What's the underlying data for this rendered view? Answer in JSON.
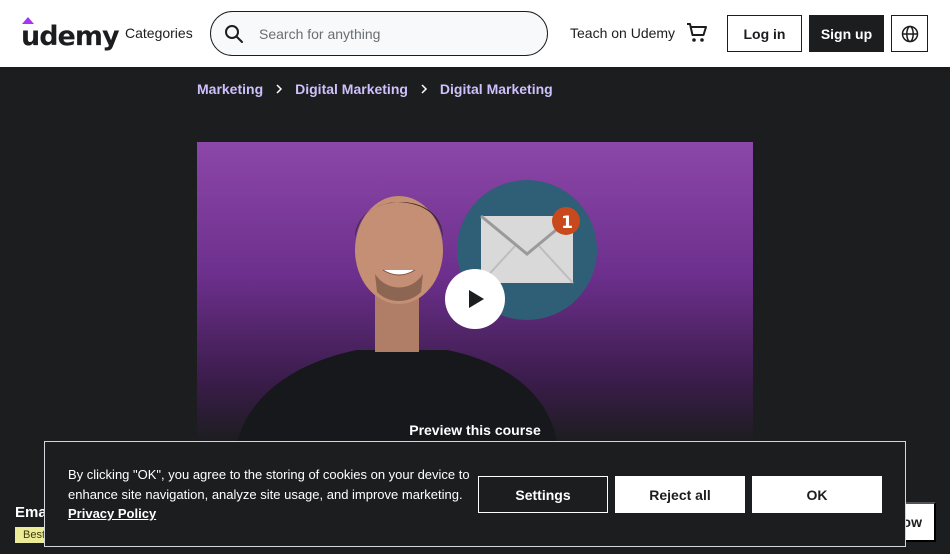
{
  "header": {
    "logo_text": "udemy",
    "categories_label": "Categories",
    "search_placeholder": "Search for anything",
    "teach_label": "Teach on Udemy",
    "login_label": "Log in",
    "signup_label": "Sign up"
  },
  "breadcrumb": [
    "Marketing",
    "Digital Marketing",
    "Digital Marketing"
  ],
  "preview": {
    "label": "Preview this course",
    "notification_count": "1"
  },
  "sticky_bar": {
    "title_partial": "Ema",
    "badge_partial": "Best",
    "button_partial": "ow"
  },
  "cookie_banner": {
    "text": "By clicking \"OK\", you agree to the storing of cookies on your device to enhance site navigation, analyze site usage, and improve marketing.",
    "link_label": "Privacy Policy",
    "settings_label": "Settings",
    "reject_label": "Reject all",
    "ok_label": "OK"
  },
  "colors": {
    "brand": "#a435f0",
    "dark": "#1c1d1f",
    "breadcrumb": "#cec0fc",
    "badge": "#eceb98"
  },
  "icons": [
    "search-icon",
    "cart-icon",
    "globe-icon",
    "chevron-right-icon",
    "play-icon",
    "envelope-icon"
  ]
}
